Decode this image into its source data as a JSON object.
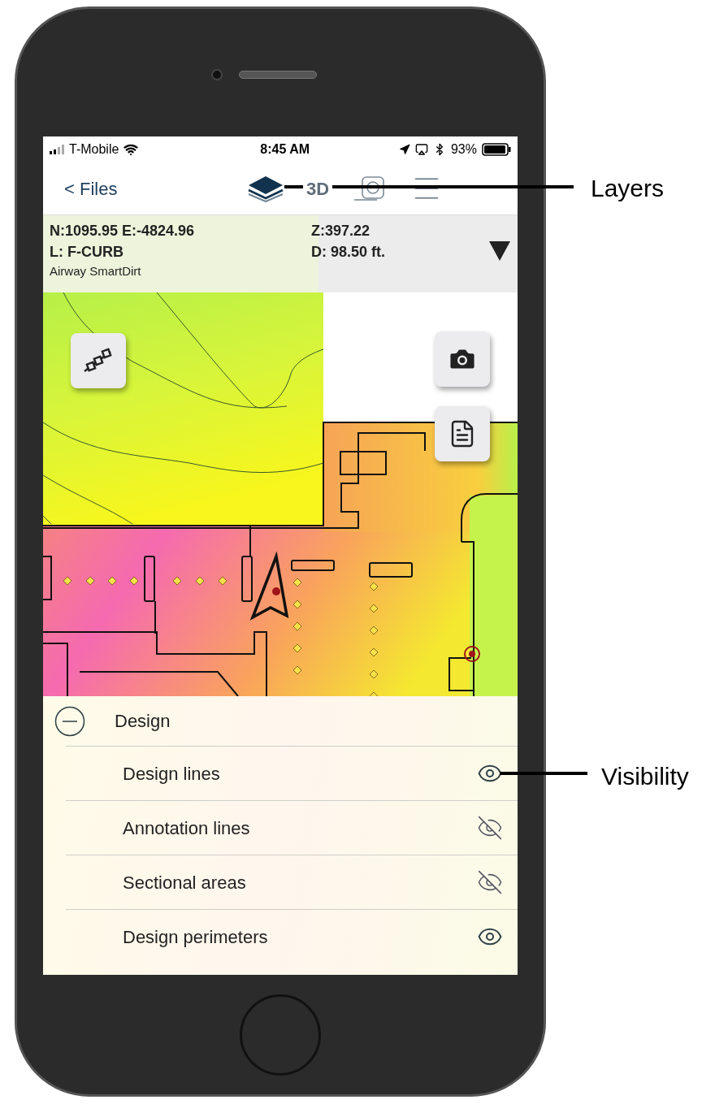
{
  "status_bar": {
    "carrier": "T-Mobile",
    "time": "8:45 AM",
    "battery": "93%"
  },
  "nav": {
    "back": "< Files",
    "tools": [
      {
        "kind": "layers",
        "selected": true
      },
      {
        "kind": "threed",
        "label": "3D",
        "selected": false
      },
      {
        "kind": "measure",
        "selected": false
      },
      {
        "kind": "menu",
        "selected": false
      }
    ]
  },
  "info": {
    "coords": "N:1095.95 E:-4824.96",
    "z": "Z:397.22",
    "layer": "L: F-CURB",
    "distance": "D: 98.50 ft.",
    "source": "Airway SmartDirt"
  },
  "map_buttons": [
    {
      "kind": "polyline"
    },
    {
      "kind": "camera"
    },
    {
      "kind": "document"
    }
  ],
  "layers_panel": {
    "group": {
      "label": "Design",
      "expanded": true
    },
    "items": [
      {
        "label": "Design lines",
        "visible": true
      },
      {
        "label": "Annotation lines",
        "visible": false
      },
      {
        "label": "Sectional areas",
        "visible": false
      },
      {
        "label": "Design perimeters",
        "visible": true
      }
    ]
  },
  "callouts": [
    {
      "label": "Layers"
    },
    {
      "label": "Visibility"
    }
  ]
}
